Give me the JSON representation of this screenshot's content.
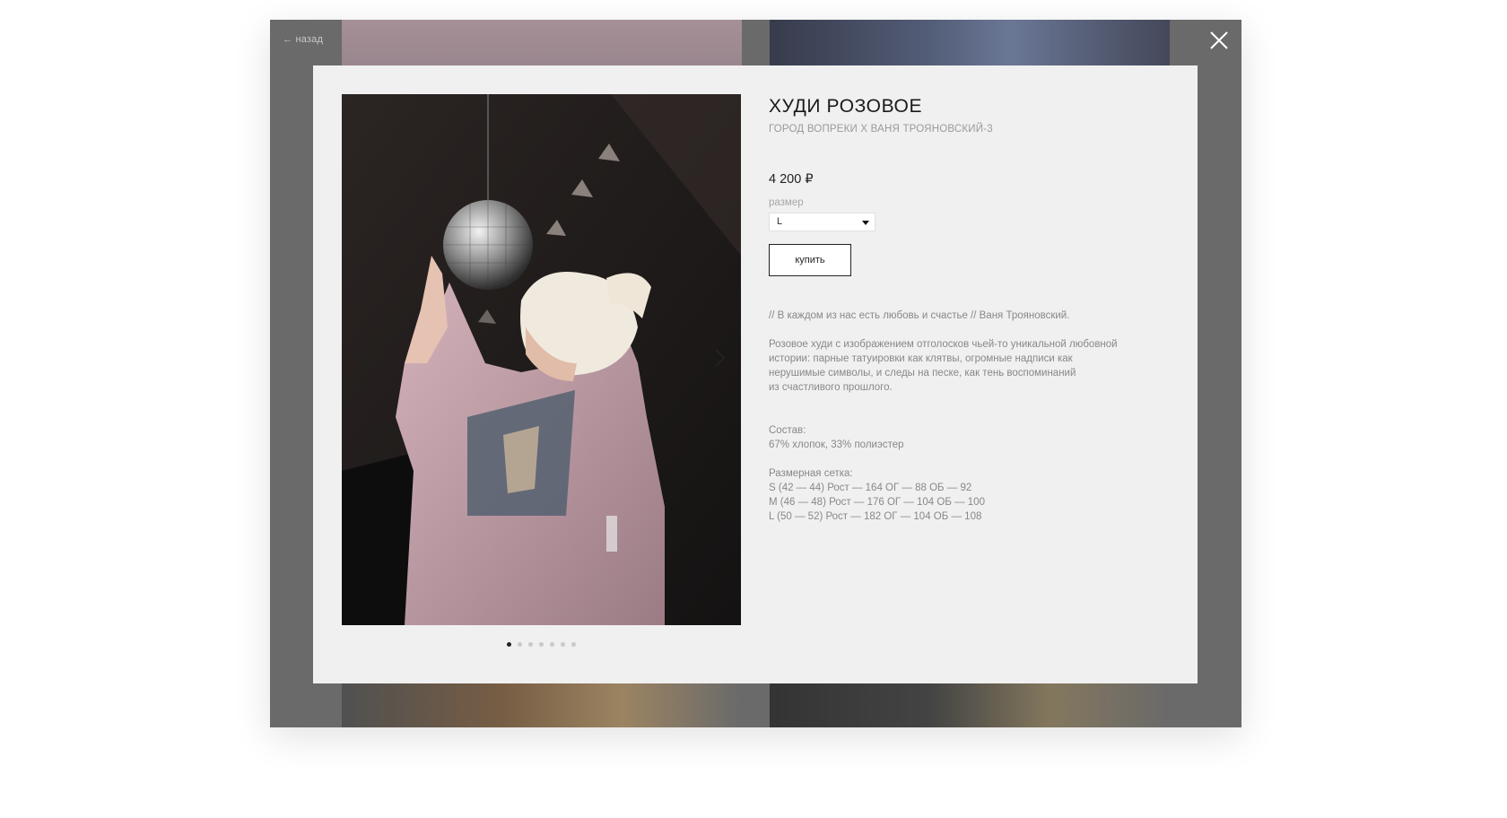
{
  "nav": {
    "back_label": "← назад"
  },
  "product": {
    "title": "ХУДИ РОЗОВОЕ",
    "subtitle": "ГОРОД ВОПРЕКИ Х ВАНЯ ТРОЯНОВСКИЙ-3",
    "price": "4 200 ₽",
    "size_label": "размер",
    "size_value": "L",
    "buy_label": "купить",
    "quote": "// В каждом из нас есть любовь и счастье // Ваня Трояновский.",
    "description": [
      "Розовое худи с изображением отголосков чьей-то уникальной любовной",
      "истории: парные татуировки как клятвы, огромные надписи как",
      "нерушимые символы, и следы на песке, как тень воспоминаний",
      "из счастливого прошлого."
    ],
    "composition": [
      "Состав:",
      "67% хлопок, 33% полиэстер"
    ],
    "size_chart": [
      "Размерная сетка:",
      "S (42 — 44) Рост — 164 ОГ — 88 ОБ — 92",
      "M (46 — 48) Рост — 176 ОГ — 104 ОБ — 100",
      "L (50 — 52) Рост — 182 ОГ — 104 ОБ — 108"
    ]
  },
  "gallery": {
    "dot_count": 7,
    "active_index": 0
  },
  "icons": {
    "close": "close-icon",
    "prev": "chevron-left-icon",
    "next": "chevron-right-icon"
  }
}
